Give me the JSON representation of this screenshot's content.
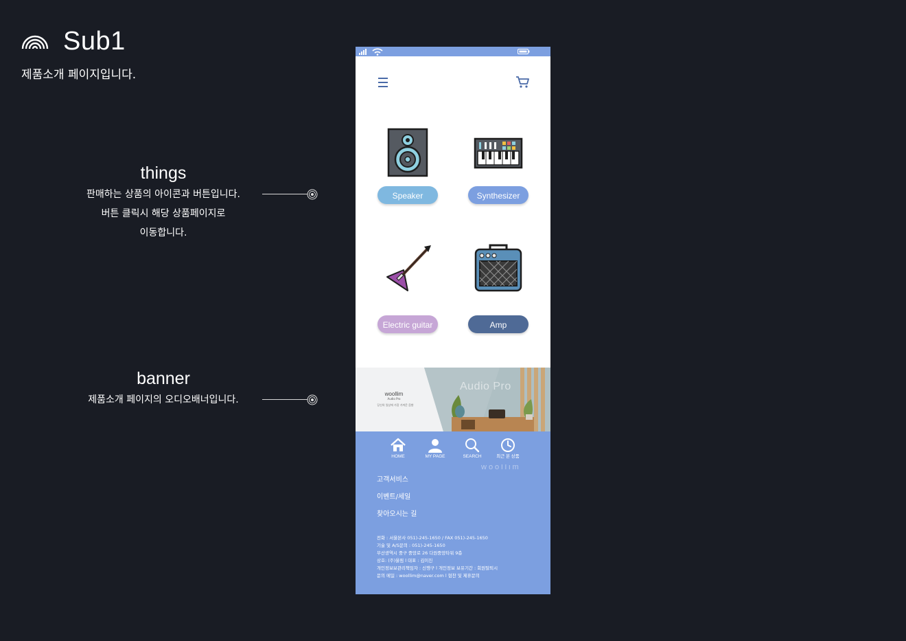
{
  "header": {
    "title": "Sub1",
    "subtitle": "제품소개 페이지입니다."
  },
  "annotations": [
    {
      "title": "things",
      "lines": [
        "판매하는 상품의 아이콘과 버튼입니다.",
        "버튼 클릭시 해당 상품페이지로",
        "이동합니다."
      ]
    },
    {
      "title": "banner",
      "lines": [
        "제품소개 페이지의 오디오배너입니다."
      ]
    }
  ],
  "phone": {
    "products": [
      {
        "label": "Speaker",
        "icon": "speaker-icon",
        "button_color": "#7fb8e0"
      },
      {
        "label": "Synthesizer",
        "icon": "synthesizer-icon",
        "button_color": "#7c9fe0"
      },
      {
        "label": "Electric guitar",
        "icon": "electric-guitar-icon",
        "button_color": "#c6a6d6"
      },
      {
        "label": "Amp",
        "icon": "amp-icon",
        "button_color": "#4f6a96"
      }
    ],
    "banner": {
      "brand": "woollim",
      "brand_sub": "Audio Pro",
      "tagline": "당신의 일상에 가장 가까운 음향",
      "headline": "Audio Pro"
    },
    "nav": [
      {
        "label": "HOME",
        "icon": "home-icon"
      },
      {
        "label": "MY PAGE",
        "icon": "user-icon"
      },
      {
        "label": "SEARCH",
        "icon": "search-icon"
      },
      {
        "label": "최근 본 상품",
        "icon": "clock-icon"
      }
    ],
    "footer": {
      "brand": "woollim",
      "links": [
        "고객서비스",
        "이벤트/세일",
        "찾아오시는 길"
      ],
      "info": [
        "전화 : 서울본사 051)-245-1650 / FAX 051)-245-1650",
        "기술 및 A/S문의 : 051)-245-1650",
        "부산광역시 중구 중앙로 26 다원중앙타워 9층",
        "상호: (주)울림 l  대표 : 김이진",
        "개인정보보관리책임자 : 신행구  l  개인정보 보유기간 : 회원탈퇴시",
        "문의 메일 : woollim@naver.com  l  협찬 및 제휴문의"
      ]
    },
    "colors": {
      "accent": "#7c9fe0",
      "background": "#191c24"
    }
  }
}
